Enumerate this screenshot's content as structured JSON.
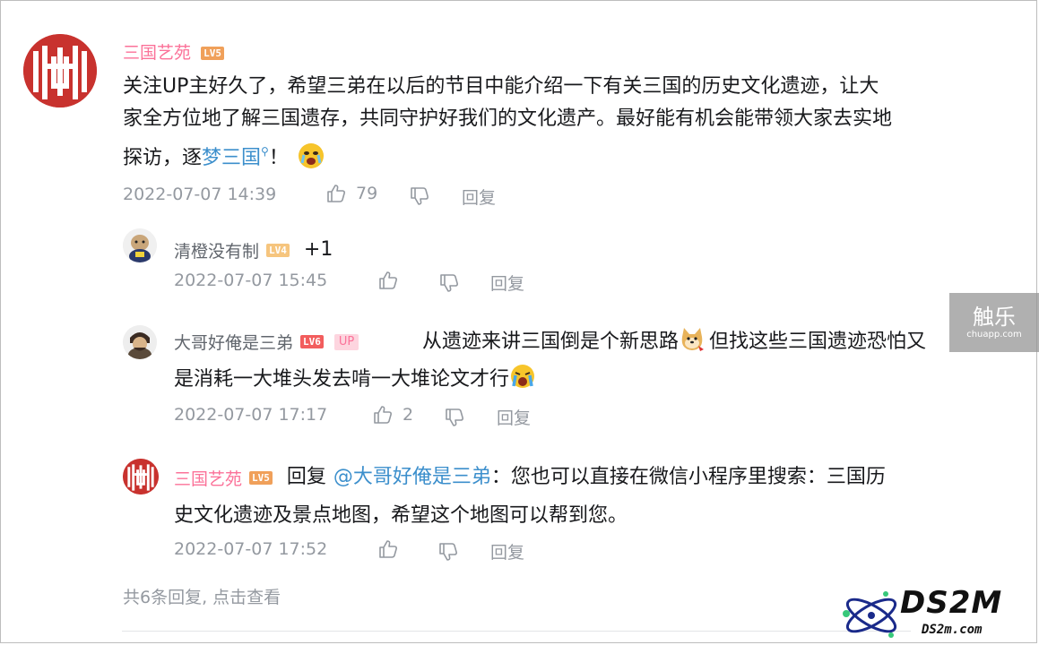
{
  "root_comment": {
    "username": "三国艺苑",
    "level": "LV5",
    "text_line1": "关注UP主好久了，希望三弟在以后的节目中能介绍一下有关三国的历史文化遗迹，让大",
    "text_line2": "家全方位地了解三国遗存，共同守护好我们的文化遗产。最好能有机会能带领大家去实地",
    "text_line3_pre": "探访，逐",
    "text_line3_link": "梦三国",
    "text_line3_post": "！",
    "timestamp": "2022-07-07 14:39",
    "likes": "79",
    "reply_label": "回复"
  },
  "replies": [
    {
      "username": "清橙没有制",
      "level": "LV4",
      "text": "+1",
      "timestamp": "2022-07-07 15:45",
      "likes": "",
      "reply_label": "回复"
    },
    {
      "username": "大哥好俺是三弟",
      "level": "LV6",
      "badge": "UP",
      "text_line1_a": "从遗迹来讲三国倒是个新思路",
      "text_line1_b": "但找这些三国遗迹恐怕又",
      "text_line2": "是消耗一大堆头发去啃一大堆论文才行",
      "timestamp": "2022-07-07 17:17",
      "likes": "2",
      "reply_label": "回复"
    },
    {
      "username": "三国艺苑",
      "level": "LV5",
      "reply_prefix": "回复",
      "mention": "@大哥好俺是三弟",
      "text_line1": "：您也可以直接在微信小程序里搜索：三国历",
      "text_line2": "史文化遗迹及景点地图，希望这个地图可以帮到您。",
      "timestamp": "2022-07-07 17:52",
      "likes": "",
      "reply_label": "回复"
    }
  ],
  "view_more": "共6条回复, 点击查看",
  "watermark_chulele": {
    "main": "触乐",
    "sub": "chuapp.com"
  },
  "watermark_ds2m": {
    "main": "DS2M",
    "sub": "DS2m.com"
  },
  "colors": {
    "username_pink": "#fb7299",
    "link_blue": "#3c8fcc",
    "meta_gray": "#9499a0",
    "avatar_red": "#c8322e"
  },
  "icons": [
    "thumbs-up-icon",
    "thumbs-down-icon",
    "search-icon"
  ]
}
